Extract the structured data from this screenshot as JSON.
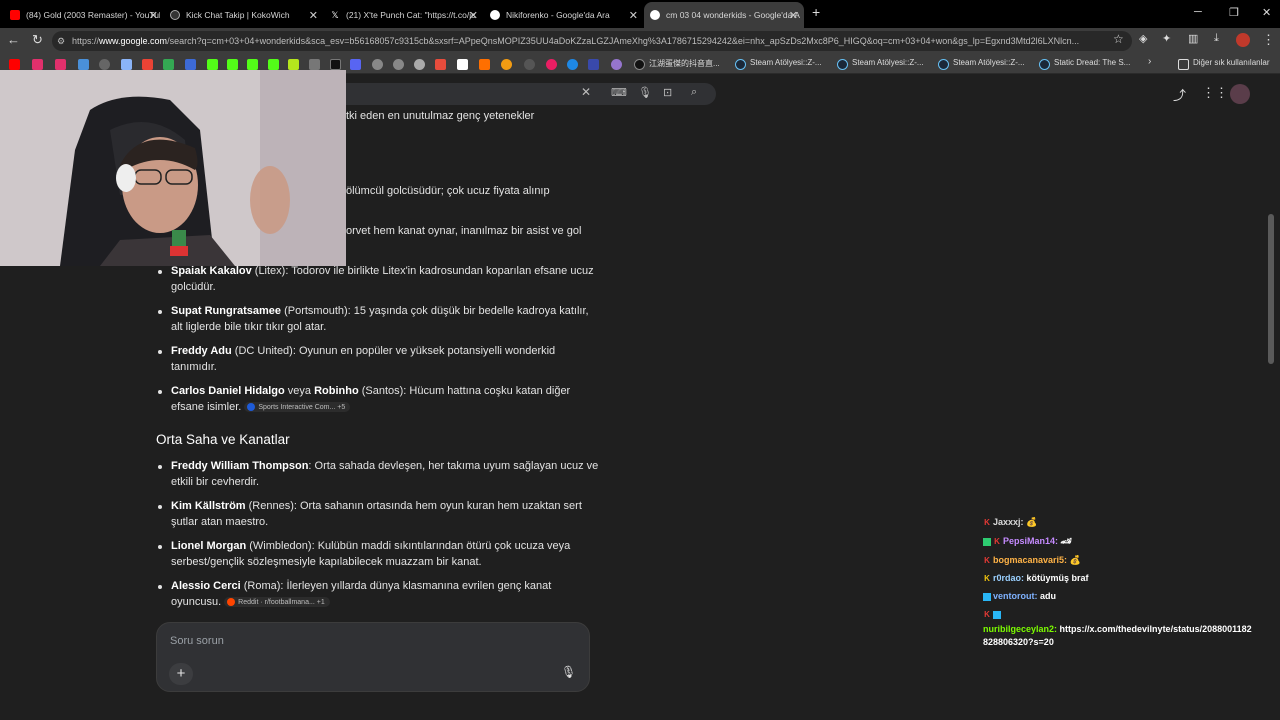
{
  "tabs": [
    {
      "title": "(84) Gold (2003 Remaster) - YouTube",
      "color": "#ff0000"
    },
    {
      "title": "Kick Chat Takip | KokoWich",
      "color": "#9aa0a6"
    },
    {
      "title": "(21) X'te Punch Cat: \"https://t.co/jc",
      "color": "#ffffff"
    },
    {
      "title": "Nikiforenko - Google'da Ara",
      "color": "#4285f4"
    },
    {
      "title": "cm 03 04 wonderkids - Google'da A",
      "color": "#4285f4"
    }
  ],
  "new_tab_label": "+",
  "address": {
    "scheme": "https://",
    "host": "www.google.com",
    "path": "/search?q=cm+03+04+wonderkids&sca_esv=b56168057c9315cb&sxsrf=APpeQnsMOPIZ35UU4aDoKZzaLGZJAmeXhg%3A1786715294242&ei=nhx_apSzDs2Mxc8P6_HIGQ&oq=cm+03+04+won&gs_lp=Egxnd3Mtd2l6LXNlcn..."
  },
  "bookmarks": {
    "chinese_label": "江湖蛋傑的抖音直...",
    "steam1": "Steam Atölyesi::Z-...",
    "steam2": "Steam Atölyesi::Z-...",
    "steam3": "Steam Atölyesi::Z-...",
    "static_dread": "Static Dread: The S...",
    "other": "Diğer sık kullanılanlar"
  },
  "content": {
    "partial1": "tki eden en unutulmaz genç yetenekler",
    "partial2": "ölümcül golcüsüdür; çok ucuz fiyata alınıp",
    "partial3": "orvet hem kanat oynar, inanılmaz bir asist ve gol",
    "forwards": [
      {
        "name": "Spaiak Kakalov",
        "club": " (Litex): ",
        "l1": "Todorov ile birlikte Litex'in kadrosundan koparılan efsane ucuz",
        "l2": "golcüdür."
      },
      {
        "name": "Supat Rungratsamee",
        "club": " (Portsmouth): ",
        "l1": "15 yaşında çok düşük bir bedelle kadroya katılır,",
        "l2": "alt liglerde bile tıkır tıkır gol atar."
      },
      {
        "name": "Freddy Adu",
        "club": " (DC United): ",
        "l1": "Oyunun en popüler ve yüksek potansiyelli wonderkid",
        "l2": "tanımıdır."
      }
    ],
    "hidalgo_name": "Carlos Daniel Hidalgo",
    "hidalgo_veya": " veya ",
    "robinho_name": "Robinho",
    "hidalgo_rest": " (Santos): Hücum hattına coşku katan diğer",
    "hidalgo_l2": "efsane isimler.",
    "chip1_label": "Sports Interactive Com...",
    "chip1_more": "+5",
    "section_heading": "Orta Saha ve Kanatlar",
    "midfield": [
      {
        "name": "Freddy William Thompson",
        "club": ": ",
        "l1": "Orta sahada devleşen, her takıma uyum sağlayan ucuz ve",
        "l2": "etkili bir cevherdir."
      },
      {
        "name": "Kim Källström",
        "club": " (Rennes): ",
        "l1": "Orta sahanın ortasında hem oyun kuran hem uzaktan sert",
        "l2": "şutlar atan maestro."
      },
      {
        "name": "Lionel Morgan",
        "club": " (Wimbledon): ",
        "l1": "Kulübün maddi sıkıntılarından ötürü çok ucuza veya",
        "l2": "serbest/gençlik sözleşmesiyle kapılabilecek muazzam bir kanat."
      }
    ],
    "cerci_name": "Alessio Cerci",
    "cerci_rest": " (Roma): İlerleyen yıllarda dünya klasmanına evrilen genç kanat",
    "cerci_l2": "oyuncusu.",
    "chip2_label": "Reddit · r/footballmana...",
    "chip2_more": "+1"
  },
  "ask": {
    "placeholder": "Soru sorun",
    "plus": "+"
  },
  "chat": [
    {
      "user": "Jaxxxj:",
      "msg": "💰",
      "color": "#d9d9d9"
    },
    {
      "user": "PepsiMan14:",
      "msg": "🏎",
      "color": "#c58bff"
    },
    {
      "user": "bogmacanavari5:",
      "msg": "💰",
      "color": "#ffb347"
    },
    {
      "user": "r0rdao:",
      "msg": "kötüymüş braf",
      "color": "#9ad0ff"
    },
    {
      "user": "ventorout:",
      "msg": "adu",
      "color": "#7fb2ff"
    },
    {
      "user": "nuribilgeceylan2:",
      "msg": "https://x.com/thedevilnyte/status/2088001182",
      "msg2": "828806320?s=20",
      "color": "#7cfc00"
    }
  ]
}
